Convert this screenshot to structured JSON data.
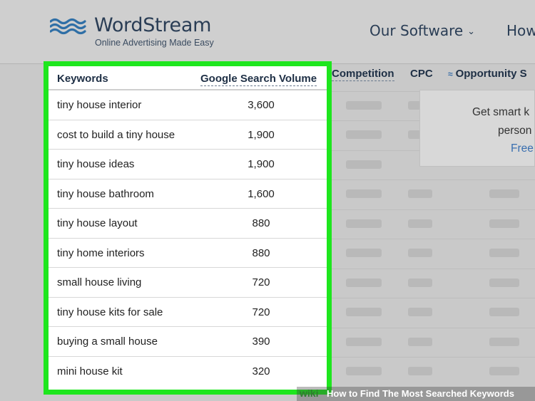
{
  "header": {
    "logo_name": "WordStream",
    "logo_tagline": "Online Advertising Made Easy",
    "nav_software": "Our Software",
    "nav_how": "How"
  },
  "columns": {
    "keywords": "Keywords",
    "volume": "Google Search Volume",
    "competition": "Competition",
    "cpc": "CPC",
    "opportunity": "Opportunity S"
  },
  "keywords": [
    {
      "keyword": "tiny house interior",
      "volume": "3,600"
    },
    {
      "keyword": "cost to build a tiny house",
      "volume": "1,900"
    },
    {
      "keyword": "tiny house ideas",
      "volume": "1,900"
    },
    {
      "keyword": "tiny house bathroom",
      "volume": "1,600"
    },
    {
      "keyword": "tiny house layout",
      "volume": "880"
    },
    {
      "keyword": "tiny home interiors",
      "volume": "880"
    },
    {
      "keyword": "small house living",
      "volume": "720"
    },
    {
      "keyword": "tiny house kits for sale",
      "volume": "720"
    },
    {
      "keyword": "buying a small house",
      "volume": "390"
    },
    {
      "keyword": "mini house kit",
      "volume": "320"
    }
  ],
  "popup": {
    "line1": "Get smart k",
    "line2": "person",
    "link": "Free"
  },
  "caption": {
    "brand": "wiki",
    "text": "How to Find The Most Searched Keywords"
  },
  "colors": {
    "highlight": "#1ee61e",
    "brand_blue": "#2a3d55",
    "link_blue": "#3a6fb0"
  }
}
